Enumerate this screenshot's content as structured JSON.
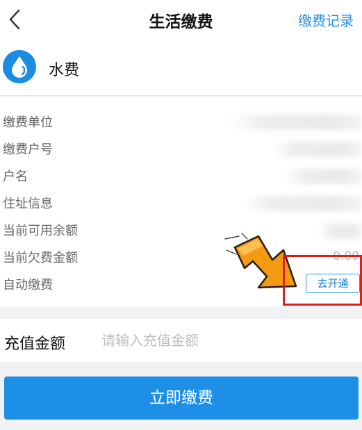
{
  "nav": {
    "title": "生活缴费",
    "records_label": "缴费记录",
    "back_icon": "chevron-left-icon"
  },
  "service": {
    "name": "水费",
    "icon": "water-drop-icon",
    "icon_color": "#1c8ce2"
  },
  "info": {
    "rows": [
      {
        "label": "缴费单位",
        "value": ""
      },
      {
        "label": "缴费户号",
        "value": ""
      },
      {
        "label": "户名",
        "value": ""
      },
      {
        "label": "住址信息",
        "value": ""
      },
      {
        "label": "当前可用余额",
        "value": ""
      },
      {
        "label": "当前欠费金额",
        "value": "0.00"
      },
      {
        "label": "自动缴费",
        "value": ""
      }
    ],
    "auto_pay_button": "去开通"
  },
  "amount": {
    "label": "充值金额",
    "placeholder": "请输入充值金额",
    "value": ""
  },
  "pay_button": "立即缴费",
  "colors": {
    "accent": "#1e8fe6",
    "highlight_box": "#d8201e",
    "arrow": "#f39a12"
  }
}
